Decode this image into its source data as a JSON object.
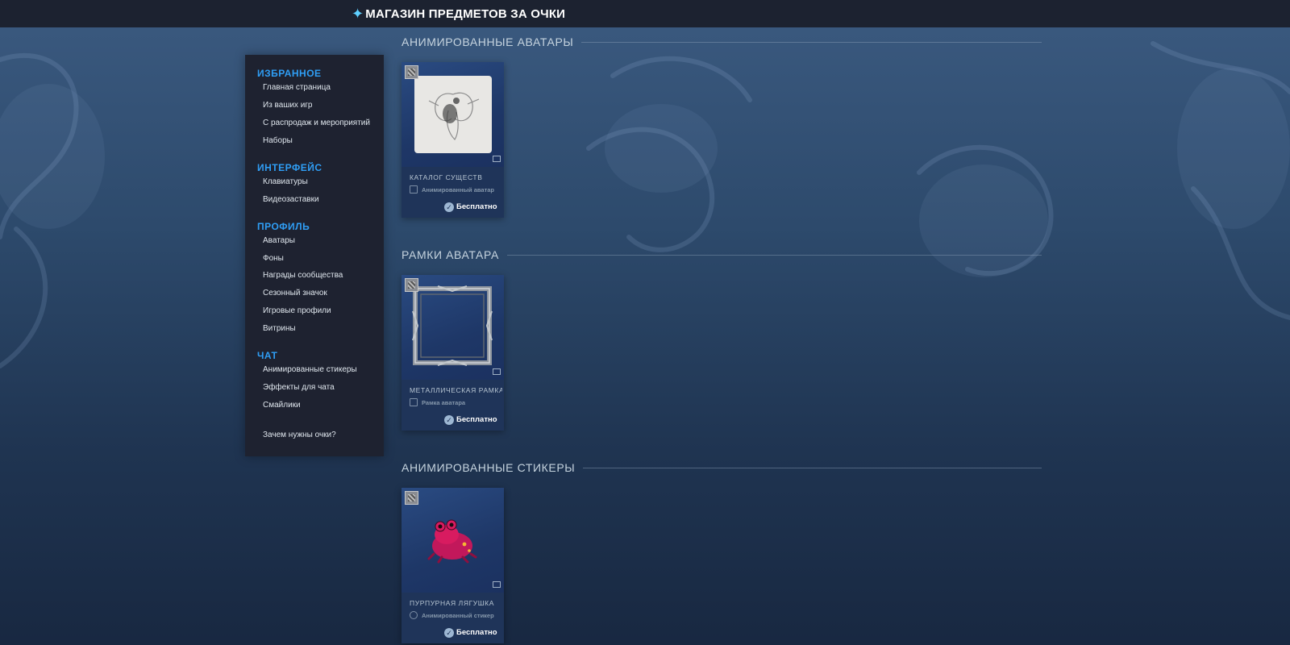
{
  "header": {
    "title": "МАГАЗИН ПРЕДМЕТОВ ЗА ОЧКИ"
  },
  "sidebar": {
    "sections": [
      {
        "title": "ИЗБРАННОЕ",
        "items": [
          "Главная страница",
          "Из ваших игр",
          "С распродаж и мероприятий",
          "Наборы"
        ]
      },
      {
        "title": "ИНТЕРФЕЙС",
        "items": [
          "Клавиатуры",
          "Видеозаставки"
        ]
      },
      {
        "title": "ПРОФИЛЬ",
        "items": [
          "Аватары",
          "Фоны",
          "Награды сообщества",
          "Сезонный значок",
          "Игровые профили",
          "Витрины"
        ]
      },
      {
        "title": "ЧАТ",
        "items": [
          "Анимированные стикеры",
          "Эффекты для чата",
          "Смайлики"
        ]
      }
    ],
    "footer_link": "Зачем нужны очки?"
  },
  "categories": [
    {
      "heading": "АНИМИРОВАННЫЕ АВАТАРЫ",
      "item": {
        "name": "КАТАЛОГ СУЩЕСТВ",
        "type": "Анимированный аватар",
        "price": "Бесплатно"
      }
    },
    {
      "heading": "РАМКИ АВАТАРА",
      "item": {
        "name": "МЕТАЛЛИЧЕСКАЯ РАМКА",
        "type": "Рамка аватара",
        "price": "Бесплатно"
      }
    },
    {
      "heading": "АНИМИРОВАННЫЕ СТИКЕРЫ",
      "item": {
        "name": "ПУРПУРНАЯ ЛЯГУШКА",
        "type": "Анимированный стикер",
        "price": "Бесплатно"
      }
    }
  ],
  "colors": {
    "accent": "#2f9ef5",
    "sidebar_bg": "#1e2230",
    "topbar_bg": "#1c2230"
  },
  "icons": {
    "title": "sparkle-icon",
    "badge": "game-badge-icon",
    "media": "animated-media-icon",
    "price": "steam-points-icon"
  }
}
